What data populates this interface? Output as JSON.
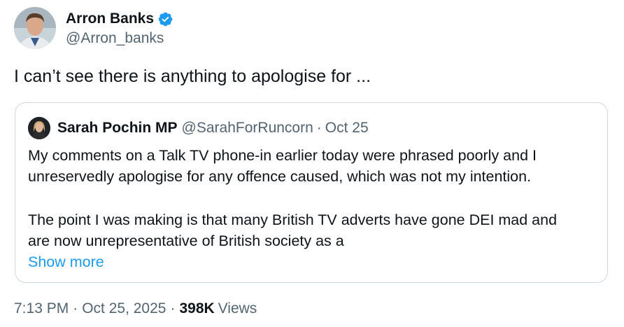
{
  "author": {
    "display_name": "Arron Banks",
    "handle": "@Arron_banks",
    "verified": true,
    "verified_color": "#1d9bf0"
  },
  "tweet": {
    "text": "I can’t see there is anything to apologise for ..."
  },
  "quote": {
    "display_name": "Sarah Pochin MP",
    "handle": "@SarahForRuncorn",
    "separator": "·",
    "date": "Oct 25",
    "body_lines": [
      "My comments on a Talk TV phone-in earlier today were phrased poorly and I",
      "unreservedly apologise for any offence caused, which was not my intention.",
      "The point I was making is that many British TV adverts have gone DEI mad and",
      "are now unrepresentative of British society as a"
    ],
    "show_more_label": "Show more"
  },
  "meta": {
    "time": "7:13 PM",
    "separator": "·",
    "date": "Oct 25, 2025",
    "views_count": "398K",
    "views_label": "Views"
  },
  "colors": {
    "text": "#0f1419",
    "secondary": "#536471",
    "link": "#1d9bf0",
    "border": "#cfd9de"
  }
}
